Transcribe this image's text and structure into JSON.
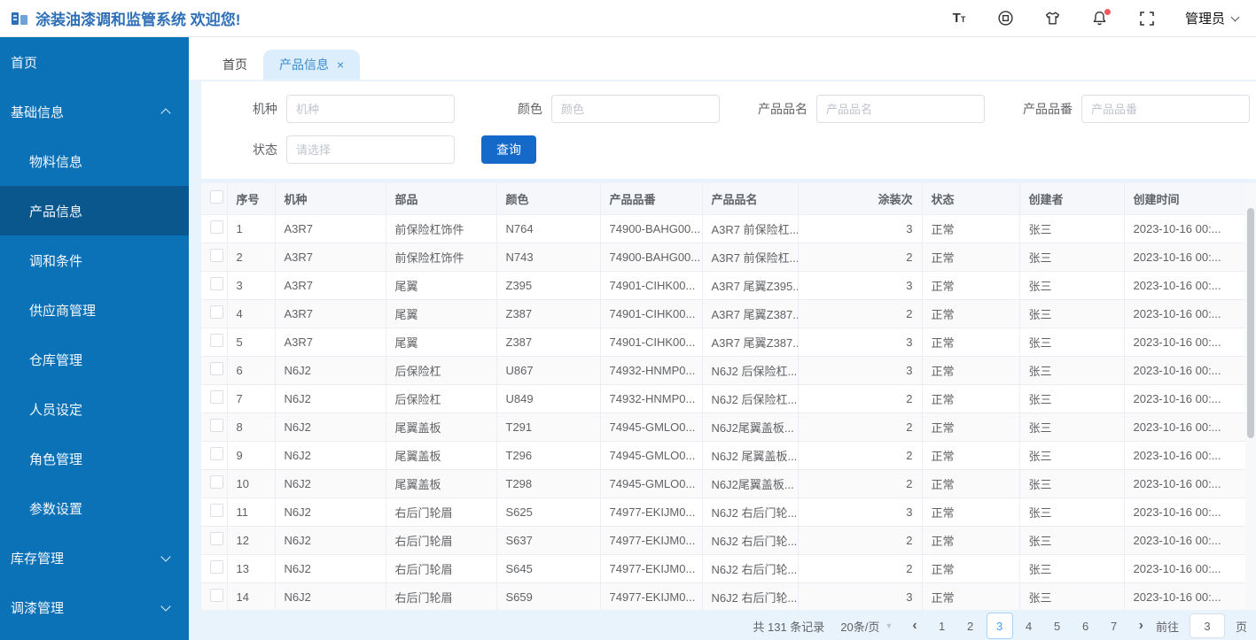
{
  "header": {
    "title": "涂装油漆调和监管系统 欢迎您!",
    "user": "管理员",
    "font_icon_big": "T",
    "font_icon_small": "T"
  },
  "sidebar": {
    "items": [
      {
        "label": "首页",
        "type": "item"
      },
      {
        "label": "基础信息",
        "type": "group",
        "arrow": "up"
      },
      {
        "label": "物料信息",
        "type": "sub"
      },
      {
        "label": "产品信息",
        "type": "sub",
        "active": true
      },
      {
        "label": "调和条件",
        "type": "sub"
      },
      {
        "label": "供应商管理",
        "type": "sub"
      },
      {
        "label": "仓库管理",
        "type": "sub"
      },
      {
        "label": "人员设定",
        "type": "sub"
      },
      {
        "label": "角色管理",
        "type": "sub"
      },
      {
        "label": "参数设置",
        "type": "sub"
      },
      {
        "label": "库存管理",
        "type": "group",
        "arrow": "down"
      },
      {
        "label": "调漆管理",
        "type": "group",
        "arrow": "down"
      }
    ]
  },
  "tabs": [
    {
      "label": "首页",
      "active": false,
      "closable": false
    },
    {
      "label": "产品信息",
      "active": true,
      "closable": true,
      "close_glyph": "×"
    }
  ],
  "search": {
    "fields": [
      {
        "label": "机种",
        "placeholder": "机种",
        "kind": "text"
      },
      {
        "label": "颜色",
        "placeholder": "颜色",
        "kind": "text"
      },
      {
        "label": "产品品名",
        "placeholder": "产品品名",
        "kind": "text"
      },
      {
        "label": "产品品番",
        "placeholder": "产品品番",
        "kind": "text"
      },
      {
        "label": "状态",
        "placeholder": "请选择",
        "kind": "select"
      }
    ],
    "query_label": "查询"
  },
  "table": {
    "columns": [
      "序号",
      "机种",
      "部品",
      "颜色",
      "产品品番",
      "产品品名",
      "涂装次",
      "状态",
      "创建者",
      "创建时间"
    ],
    "rows": [
      [
        "1",
        "A3R7",
        "前保险杠饰件",
        "N764",
        "74900-BAHG00...",
        "A3R7 前保险杠...",
        "3",
        "正常",
        "张三",
        "2023-10-16 00:..."
      ],
      [
        "2",
        "A3R7",
        "前保险杠饰件",
        "N743",
        "74900-BAHG00...",
        "A3R7 前保险杠...",
        "2",
        "正常",
        "张三",
        "2023-10-16 00:..."
      ],
      [
        "3",
        "A3R7",
        "尾翼",
        "Z395",
        "74901-CIHK00...",
        "A3R7 尾翼Z395...",
        "3",
        "正常",
        "张三",
        "2023-10-16 00:..."
      ],
      [
        "4",
        "A3R7",
        "尾翼",
        "Z387",
        "74901-CIHK00...",
        "A3R7 尾翼Z387...",
        "2",
        "正常",
        "张三",
        "2023-10-16 00:..."
      ],
      [
        "5",
        "A3R7",
        "尾翼",
        "Z387",
        "74901-CIHK00...",
        "A3R7 尾翼Z387...",
        "3",
        "正常",
        "张三",
        "2023-10-16 00:..."
      ],
      [
        "6",
        "N6J2",
        "后保险杠",
        "U867",
        "74932-HNMP0...",
        "N6J2 后保险杠...",
        "3",
        "正常",
        "张三",
        "2023-10-16 00:..."
      ],
      [
        "7",
        "N6J2",
        "后保险杠",
        "U849",
        "74932-HNMP0...",
        "N6J2 后保险杠...",
        "2",
        "正常",
        "张三",
        "2023-10-16 00:..."
      ],
      [
        "8",
        "N6J2",
        "尾翼盖板",
        "T291",
        "74945-GMLO0...",
        "N6J2尾翼盖板...",
        "2",
        "正常",
        "张三",
        "2023-10-16 00:..."
      ],
      [
        "9",
        "N6J2",
        "尾翼盖板",
        "T296",
        "74945-GMLO0...",
        "N6J2 尾翼盖板...",
        "2",
        "正常",
        "张三",
        "2023-10-16 00:..."
      ],
      [
        "10",
        "N6J2",
        "尾翼盖板",
        "T298",
        "74945-GMLO0...",
        "N6J2尾翼盖板...",
        "2",
        "正常",
        "张三",
        "2023-10-16 00:..."
      ],
      [
        "11",
        "N6J2",
        "右后门轮眉",
        "S625",
        "74977-EKIJM0...",
        "N6J2 右后门轮...",
        "3",
        "正常",
        "张三",
        "2023-10-16 00:..."
      ],
      [
        "12",
        "N6J2",
        "右后门轮眉",
        "S637",
        "74977-EKIJM0...",
        "N6J2 右后门轮...",
        "2",
        "正常",
        "张三",
        "2023-10-16 00:..."
      ],
      [
        "13",
        "N6J2",
        "右后门轮眉",
        "S645",
        "74977-EKIJM0...",
        "N6J2 右后门轮...",
        "2",
        "正常",
        "张三",
        "2023-10-16 00:..."
      ],
      [
        "14",
        "N6J2",
        "右后门轮眉",
        "S659",
        "74977-EKIJM0...",
        "N6J2 右后门轮...",
        "3",
        "正常",
        "张三",
        "2023-10-16 00:..."
      ]
    ]
  },
  "pagination": {
    "total_text": "共 131 条记录",
    "page_size": "20条/页",
    "prev_glyph": "‹",
    "next_glyph": "›",
    "pages": [
      "1",
      "2",
      "3",
      "4",
      "5",
      "6",
      "7"
    ],
    "current": "3",
    "goto_label": "前往",
    "goto_value": "3",
    "goto_suffix": "页"
  },
  "colors": {
    "sidebar_bg": "#0c72b7",
    "sidebar_active_bg": "#0a578e",
    "title_blue": "#2e6fb8",
    "primary_button": "#1569c8",
    "tab_active_bg": "#dceefb",
    "tab_active_text": "#3a8ccd",
    "content_bg": "#e9f3fb",
    "table_header_bg": "#f5f7fa",
    "table_border": "#ebeef5",
    "pagination_active": "#409eff",
    "notification_dot": "#f0585c"
  }
}
